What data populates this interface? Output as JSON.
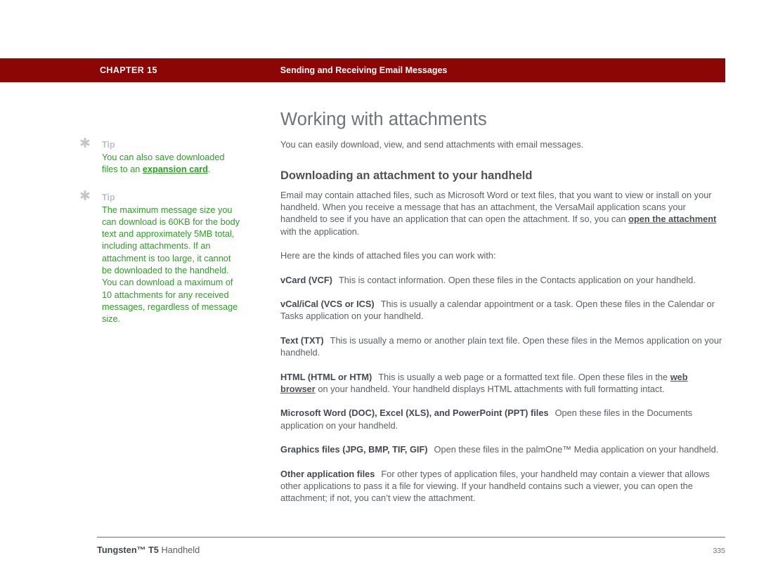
{
  "header": {
    "chapter_label": "CHAPTER 15",
    "running_title": "Sending and Receiving Email Messages",
    "bar_color": "#8d0606"
  },
  "sidebar": {
    "tips": [
      {
        "icon": "asterisk-icon",
        "label": "Tip",
        "text_before": "You can also save downloaded files to an ",
        "link": "expansion card",
        "text_after": "."
      },
      {
        "icon": "asterisk-icon",
        "label": "Tip",
        "text_before": "The maximum message size you can download is 60KB for the body text and approximately 5MB total, including attachments. If an attachment is too large, it cannot be downloaded to the handheld. You can download a maximum of 10 attachments for any received messages, regardless of message size.",
        "link": "",
        "text_after": ""
      }
    ],
    "link_color": "#2ba024",
    "text_color": "#2ba024"
  },
  "main": {
    "page_title": "Working with attachments",
    "intro": "You can easily download, view, and send attachments with email messages.",
    "section_title": "Downloading an attachment to your handheld",
    "section_para_1a": "Email may contain attached files, such as Microsoft Word or text files, that you want to view or install on your handheld. When you receive a message that has an attachment, the VersaMail application scans your handheld to see if you have an application that can open the attachment. If so, you can ",
    "section_para_1_link": "open the attachment",
    "section_para_1b": " with the application.",
    "list_lead": "Here are the kinds of attached files you can work with:",
    "file_types": [
      {
        "term": "vCard (VCF)",
        "desc_a": "This is contact information. Open these files in the Contacts application on your handheld.",
        "link": "",
        "desc_b": ""
      },
      {
        "term": "vCal/iCal (VCS or ICS)",
        "desc_a": "This is usually a calendar appointment or a task. Open these files in the Calendar or Tasks application on your handheld.",
        "link": "",
        "desc_b": ""
      },
      {
        "term": "Text (TXT)",
        "desc_a": "This is usually a memo or another plain text file. Open these files in the Memos application on your handheld.",
        "link": "",
        "desc_b": ""
      },
      {
        "term": "HTML (HTML or HTM)",
        "desc_a": "This is usually a web page or a formatted text file. Open these files in the ",
        "link": "web browser",
        "desc_b": " on your handheld. Your handheld displays HTML attachments with full formatting intact."
      },
      {
        "term": "Microsoft Word (DOC), Excel (XLS), and PowerPoint (PPT) files",
        "desc_a": "Open these files in the Documents application on your handheld.",
        "link": "",
        "desc_b": ""
      },
      {
        "term": "Graphics files (JPG, BMP, TIF, GIF)",
        "desc_a": "Open these files in the palmOne™ Media application on your handheld.",
        "link": "",
        "desc_b": ""
      },
      {
        "term": "Other application files",
        "desc_a": "For other types of application files, your handheld may contain a viewer that allows other applications to pass it a file for viewing. If your handheld contains such a viewer, you can open the attachment; if not, you can’t view the attachment.",
        "link": "",
        "desc_b": ""
      }
    ]
  },
  "footer": {
    "product_bold": "Tungsten™ T5",
    "product_rest": " Handheld",
    "page_number": "335"
  }
}
